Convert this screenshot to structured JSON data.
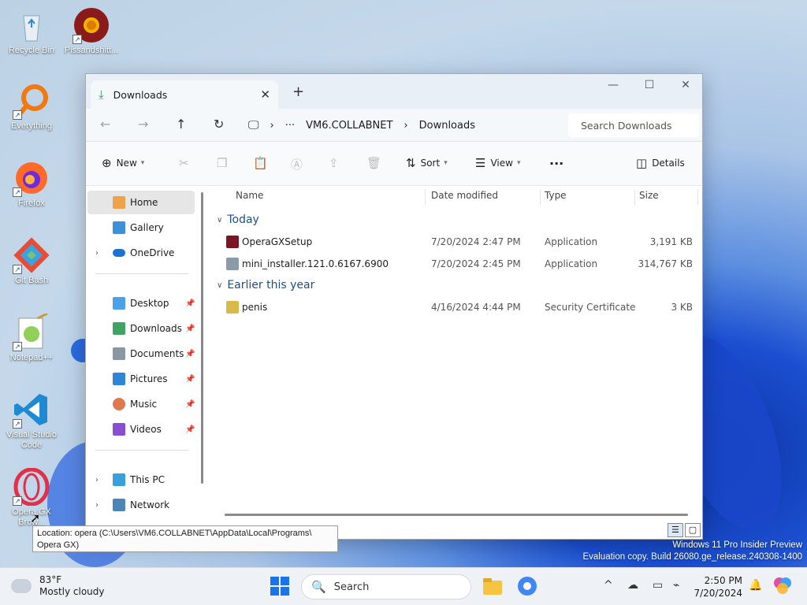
{
  "desktop": {
    "icons": [
      {
        "label": "Recycle Bin",
        "icon": "recycle-bin-icon"
      },
      {
        "label": "Pissandshitt...",
        "icon": "chrome-icon"
      },
      {
        "label": "Everything",
        "icon": "everything-search-icon"
      },
      {
        "label": "Firefox",
        "icon": "firefox-icon"
      },
      {
        "label": "Git Bash",
        "icon": "git-bash-icon"
      },
      {
        "label": "Notepad++",
        "icon": "notepad-plus-plus-icon"
      },
      {
        "label": "Visual Studio Code",
        "icon": "vscode-icon"
      },
      {
        "label": "Opera GX Brow...",
        "icon": "opera-gx-icon"
      }
    ],
    "tooltip": {
      "line1": "Location: opera (C:\\Users\\VM6.COLLABNET\\AppData\\Local\\Programs\\",
      "line2": "Opera GX)"
    },
    "watermark": {
      "line1": "Windows 11 Pro Insider Preview",
      "line2": "Evaluation copy. Build 26080.ge_release.240308-1400"
    }
  },
  "explorer": {
    "tab_title": "Downloads",
    "address": {
      "segments": [
        "VM6.COLLABNET",
        "Downloads"
      ],
      "ellipsis": "···"
    },
    "search_placeholder": "Search Downloads",
    "commands": {
      "new_label": "New",
      "sort_label": "Sort",
      "view_label": "View",
      "more_label": "···",
      "details_label": "Details"
    },
    "sidebar": {
      "home": "Home",
      "gallery": "Gallery",
      "onedrive": "OneDrive",
      "quick": [
        "Desktop",
        "Downloads",
        "Documents",
        "Pictures",
        "Music",
        "Videos"
      ],
      "this_pc": "This PC",
      "network": "Network"
    },
    "columns": {
      "name": "Name",
      "date": "Date modified",
      "type": "Type",
      "size": "Size"
    },
    "groups": [
      {
        "label": "Today",
        "files": [
          {
            "name": "OperaGXSetup",
            "date": "7/20/2024 2:47 PM",
            "type": "Application",
            "size": "3,191 KB",
            "icon_color": "#7a1524"
          },
          {
            "name": "mini_installer.121.0.6167.6900",
            "date": "7/20/2024 2:45 PM",
            "type": "Application",
            "size": "314,767 KB",
            "icon_color": "#8a9aa8"
          }
        ]
      },
      {
        "label": "Earlier this year",
        "files": [
          {
            "name": "penis",
            "date": "4/16/2024 4:44 PM",
            "type": "Security Certificate",
            "size": "3 KB",
            "icon_color": "#d9b94a"
          }
        ]
      }
    ]
  },
  "taskbar": {
    "weather": {
      "temp": "83°F",
      "condition": "Mostly cloudy"
    },
    "search_label": "Search",
    "clock": {
      "time": "2:50 PM",
      "date": "7/20/2024"
    }
  },
  "colors": {
    "accent": "#0067c0",
    "window_bg": "#ffffff",
    "taskbar_bg": "#eef2f7"
  }
}
